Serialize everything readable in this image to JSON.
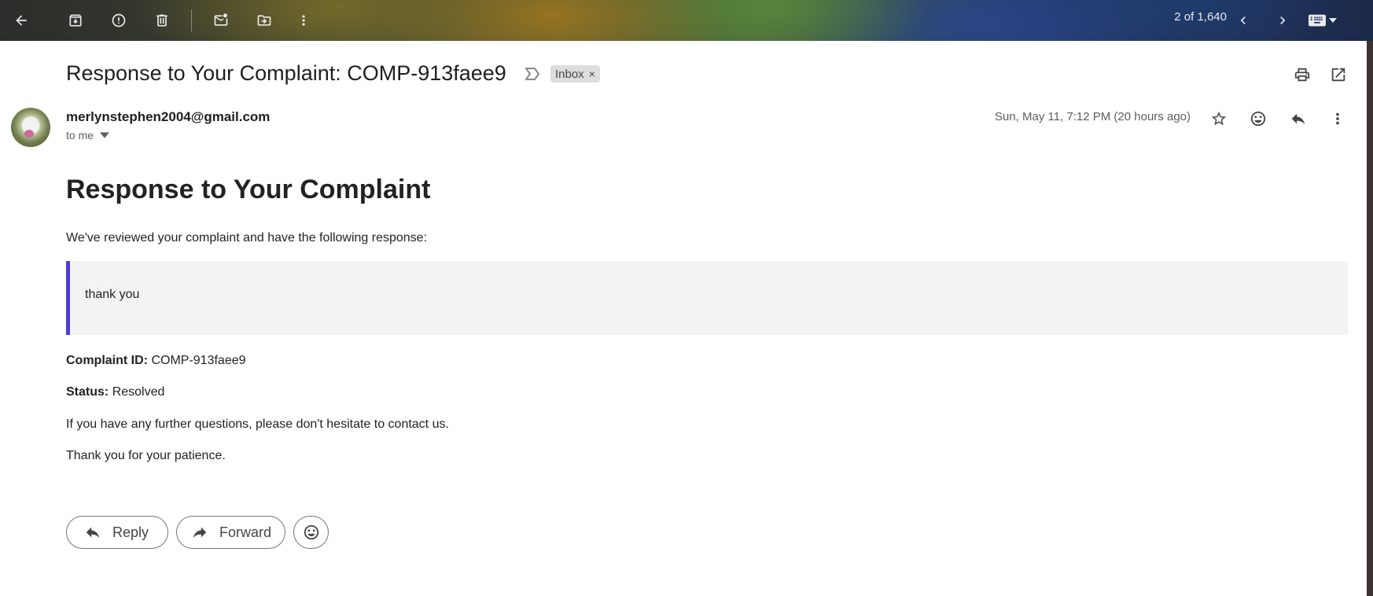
{
  "toolbar": {
    "pager_text": "2 of 1,640"
  },
  "email": {
    "subject": "Response to Your Complaint: COMP-913faee9",
    "label": "Inbox",
    "label_remove": "×",
    "sender": "merlynstephen2004@gmail.com",
    "recipient": "to me",
    "date": "Sun, May 11, 7:12 PM (20 hours ago)"
  },
  "body": {
    "heading": "Response to Your Complaint",
    "intro": "We've reviewed your complaint and have the following response:",
    "quote": "thank you",
    "complaint_id_label": "Complaint ID:",
    "complaint_id_value": "COMP-913faee9",
    "status_label": "Status:",
    "status_value": "Resolved",
    "further": "If you have any further questions, please don't hesitate to contact us.",
    "thanks": "Thank you for your patience."
  },
  "actions": {
    "reply": "Reply",
    "forward": "Forward"
  },
  "colors": {
    "quote_border": "#4a3fd6",
    "quote_background": "#f3f3f3"
  }
}
